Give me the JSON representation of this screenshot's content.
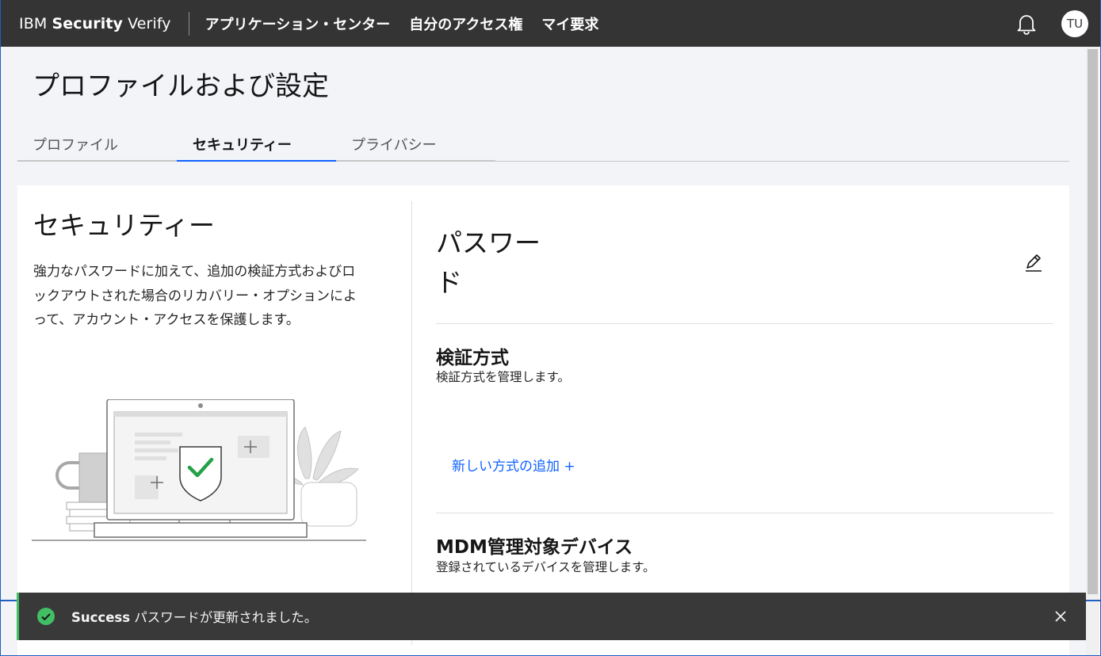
{
  "header": {
    "brand_prefix": "IBM",
    "brand_bold": "Security",
    "brand_suffix": "Verify",
    "nav": [
      {
        "label": "アプリケーション・センター"
      },
      {
        "label": "自分のアクセス権"
      },
      {
        "label": "マイ要求"
      }
    ],
    "notification_icon": "bell-icon",
    "avatar_initials": "TU"
  },
  "page": {
    "title": "プロファイルおよび設定",
    "tabs": [
      {
        "label": "プロファイル",
        "active": false
      },
      {
        "label": "セキュリティー",
        "active": true
      },
      {
        "label": "プライバシー",
        "active": false
      }
    ]
  },
  "security": {
    "title": "セキュリティー",
    "description": "強力なパスワードに加えて、追加の検証方式およびロックアウトされた場合のリカバリー・オプションによって、アカウント・アクセスを保護します。",
    "illustration_icon": "laptop-shield-illustration"
  },
  "password": {
    "title": "パスワード",
    "edit_icon": "pencil-icon"
  },
  "verification": {
    "title": "検証方式",
    "description": "検証方式を管理します。",
    "add_link": "新しい方式の追加 +"
  },
  "mdm": {
    "title": "MDM管理対象デバイス",
    "description": "登録されているデバイスを管理します。"
  },
  "toast": {
    "status": "Success",
    "message": "パスワードが更新されました。",
    "icon": "checkmark-filled-icon",
    "close_icon": "close-icon",
    "accent_color": "#42be65"
  },
  "colors": {
    "header_bg": "#343434",
    "link": "#0f62fe",
    "page_bg": "#f2f4f8",
    "success": "#24a148"
  }
}
